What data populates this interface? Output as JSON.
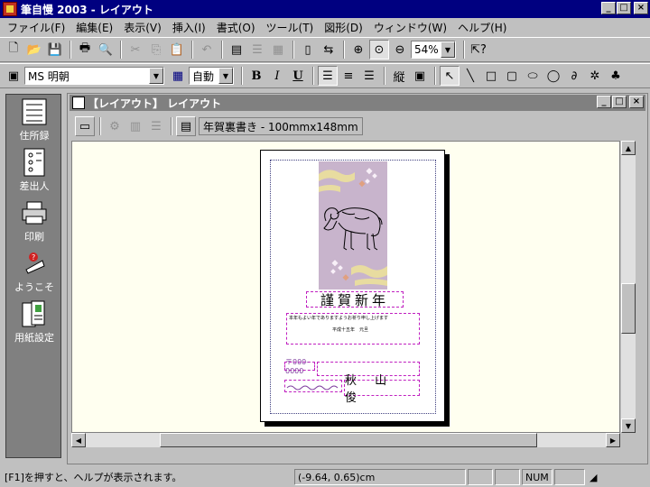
{
  "app": {
    "title": "筆自慢 2003 - レイアウト",
    "caption_buttons": {
      "minimize": "_",
      "maximize": "□",
      "close": "×"
    }
  },
  "menu": [
    "ファイル(F)",
    "編集(E)",
    "表示(V)",
    "挿入(I)",
    "書式(O)",
    "ツール(T)",
    "図形(D)",
    "ウィンドウ(W)",
    "ヘルプ(H)"
  ],
  "toolbar1": {
    "zoom_value": "54%"
  },
  "toolbar2": {
    "font_name": "MS 明朝",
    "font_size": "自動",
    "bold": "B",
    "italic": "I",
    "underline": "U",
    "vertical": "縦"
  },
  "left_panel": [
    {
      "label": "住所録",
      "icon": "address-book-icon"
    },
    {
      "label": "差出人",
      "icon": "sender-icon"
    },
    {
      "label": "印刷",
      "icon": "printer-icon"
    },
    {
      "label": "ようこそ",
      "icon": "welcome-icon"
    },
    {
      "label": "用紙設定",
      "icon": "paper-setup-icon"
    }
  ],
  "child_window": {
    "title": "【レイアウト】 レイアウト",
    "paper_size": "年賀裏書き - 100mmx148mm"
  },
  "card": {
    "greeting": "謹賀新年",
    "message": "本年もよい年でありますようお祈り申し上げます",
    "date_line": "平成十五年　元旦",
    "postal_placeholder": "〒000-0000",
    "name": "秋 山 俊",
    "image_bg": "#c8b4cc"
  },
  "status": {
    "help": "[F1]を押すと、ヘルプが表示されます。",
    "coords": "(-9.64, 0.65)cm",
    "num": "NUM"
  },
  "colors": {
    "title_active": "#000080",
    "title_inactive": "#808080",
    "canvas_bg": "#fffff0",
    "guide_dash": "#c020c0"
  }
}
